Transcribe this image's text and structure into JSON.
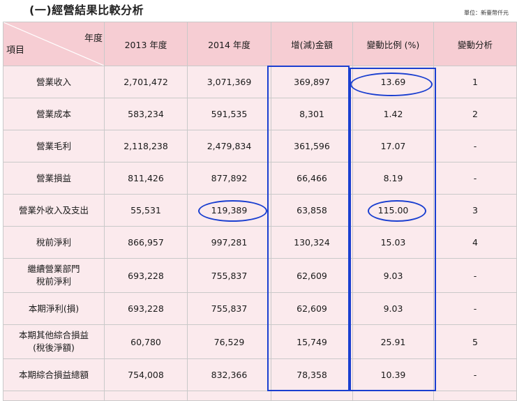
{
  "page": {
    "title": "(一)經營結果比較分析",
    "unit": "單位：新臺幣仟元"
  },
  "table": {
    "corner_top": "年度",
    "corner_bottom": "項目",
    "headers": [
      "2013 年度",
      "2014 年度",
      "增(減)金額",
      "變動比例 (%)",
      "變動分析"
    ],
    "rows": [
      {
        "item": [
          "營業收入"
        ],
        "y2013": "2,701,472",
        "y2014": "3,071,369",
        "change": "369,897",
        "pct": "13.69",
        "note": "1"
      },
      {
        "item": [
          "營業成本"
        ],
        "y2013": "583,234",
        "y2014": "591,535",
        "change": "8,301",
        "pct": "1.42",
        "note": "2"
      },
      {
        "item": [
          "營業毛利"
        ],
        "y2013": "2,118,238",
        "y2014": "2,479,834",
        "change": "361,596",
        "pct": "17.07",
        "note": "-"
      },
      {
        "item": [
          "營業損益"
        ],
        "y2013": "811,426",
        "y2014": "877,892",
        "change": "66,466",
        "pct": "8.19",
        "note": "-"
      },
      {
        "item": [
          "營業外收入及支出"
        ],
        "y2013": "55,531",
        "y2014": "119,389",
        "change": "63,858",
        "pct": "115.00",
        "note": "3"
      },
      {
        "item": [
          "稅前淨利"
        ],
        "y2013": "866,957",
        "y2014": "997,281",
        "change": "130,324",
        "pct": "15.03",
        "note": "4"
      },
      {
        "item": [
          "繼續營業部門",
          "稅前淨利"
        ],
        "y2013": "693,228",
        "y2014": "755,837",
        "change": "62,609",
        "pct": "9.03",
        "note": "-"
      },
      {
        "item": [
          "本期淨利(損)"
        ],
        "y2013": "693,228",
        "y2014": "755,837",
        "change": "62,609",
        "pct": "9.03",
        "note": "-"
      },
      {
        "item": [
          "本期其他綜合損益",
          "(稅後淨額)"
        ],
        "y2013": "60,780",
        "y2014": "76,529",
        "change": "15,749",
        "pct": "25.91",
        "note": "5"
      },
      {
        "item": [
          "本期綜合損益總額"
        ],
        "y2013": "754,008",
        "y2014": "832,366",
        "change": "78,358",
        "pct": "10.39",
        "note": "-"
      }
    ]
  },
  "colors": {
    "header_bg": "#f6cdd3",
    "row_bg": "#fbeaed",
    "highlight": "#1a3fd0"
  }
}
